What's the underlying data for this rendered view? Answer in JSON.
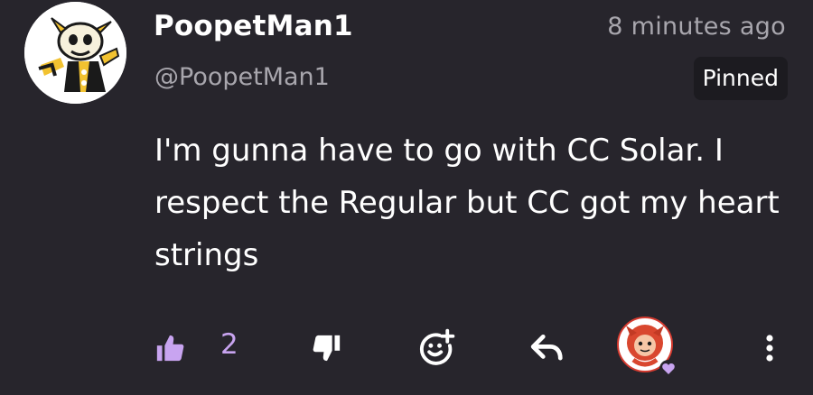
{
  "post": {
    "author_name": "PoopetMan1",
    "author_handle": "@PoopetMan1",
    "timestamp": "8 minutes ago",
    "pinned_label": "Pinned",
    "body": "I'm gunna have to go with CC Solar. I respect the Regular but CC got my heart strings"
  },
  "actions": {
    "like_count": "2",
    "icons": [
      "thumbs-up-icon",
      "thumbs-down-icon",
      "add-reaction-icon",
      "reply-icon",
      "reactor-avatar",
      "more-options-icon"
    ]
  },
  "colors": {
    "background": "#27252c",
    "accent": "#c8a4f0",
    "secondary_text": "#a8a6ad",
    "badge_bg": "#1c1b20"
  }
}
